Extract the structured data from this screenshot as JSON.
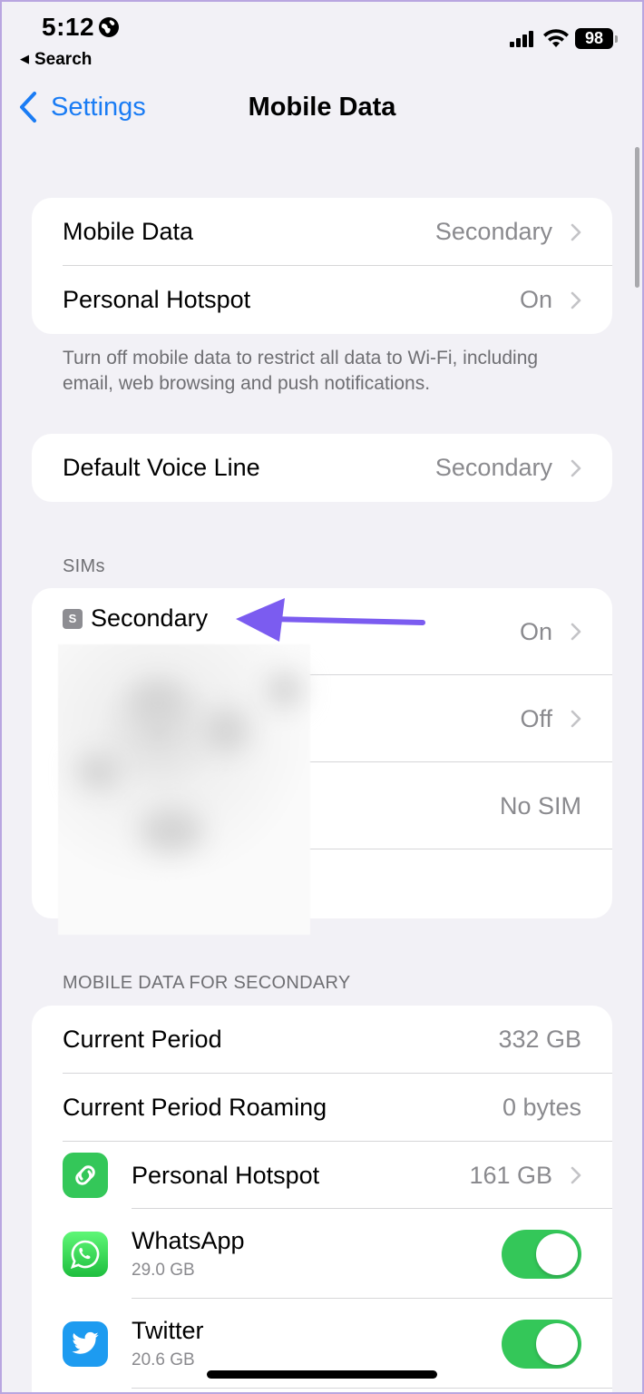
{
  "status_bar": {
    "time": "5:12",
    "back_app": "Search",
    "battery": "98"
  },
  "nav": {
    "back_label": "Settings",
    "title": "Mobile Data"
  },
  "group1": {
    "rows": [
      {
        "label": "Mobile Data",
        "value": "Secondary"
      },
      {
        "label": "Personal Hotspot",
        "value": "On"
      }
    ],
    "footer": "Turn off mobile data to restrict all data to Wi-Fi, including email, web browsing and push notifications."
  },
  "group2": {
    "rows": [
      {
        "label": "Default Voice Line",
        "value": "Secondary"
      }
    ]
  },
  "sims": {
    "header": "SIMs",
    "rows": [
      {
        "badge": "S",
        "label": "Secondary",
        "value": "On"
      },
      {
        "value": "Off"
      },
      {
        "value": "No SIM"
      }
    ]
  },
  "usage": {
    "header": "MOBILE DATA FOR SECONDARY",
    "rows": [
      {
        "label": "Current Period",
        "value": "332 GB"
      },
      {
        "label": "Current Period Roaming",
        "value": "0 bytes"
      },
      {
        "label": "Personal Hotspot",
        "value": "161 GB"
      }
    ],
    "apps": [
      {
        "name": "WhatsApp",
        "usage": "29.0 GB",
        "enabled": true
      },
      {
        "name": "Twitter",
        "usage": "20.6 GB",
        "enabled": true
      }
    ]
  },
  "colors": {
    "accent": "#1a7cf4",
    "toggle_on": "#34c759",
    "hotspot_icon": "#34c759",
    "whatsapp_icon": "#25d366",
    "twitter_icon": "#1d9bf0",
    "annotation_arrow": "#7b5cf0"
  }
}
